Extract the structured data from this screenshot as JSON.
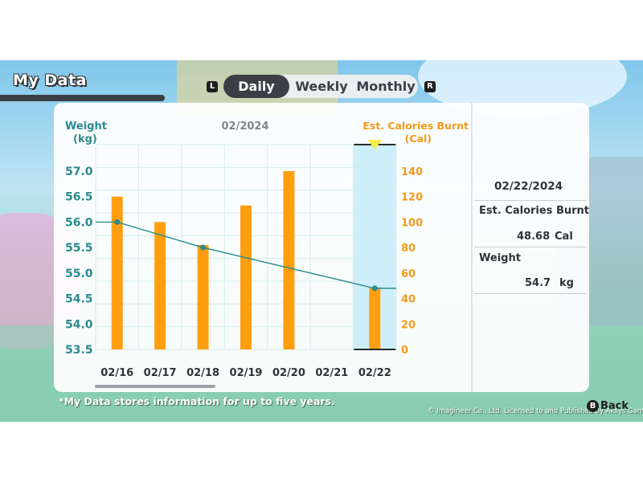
{
  "header": {
    "title": "My Data"
  },
  "tabs": [
    {
      "label": "Daily",
      "selected": true
    },
    {
      "label": "Weekly",
      "selected": false
    },
    {
      "label": "Monthly",
      "selected": false
    }
  ],
  "keys": {
    "left": "L",
    "right": "R",
    "back": "B"
  },
  "chart_header": {
    "left_axis_title": [
      "Weight",
      "(kg)"
    ],
    "period": "02/2024",
    "right_axis_title": [
      "Est. Calories Burnt",
      "(Cal)"
    ]
  },
  "chart_data": {
    "type": "bar",
    "categories": [
      "02/16",
      "02/17",
      "02/18",
      "02/19",
      "02/20",
      "02/21",
      "02/22"
    ],
    "series": [
      {
        "name": "Est. Calories Burnt",
        "axis": "right",
        "kind": "bar",
        "values": [
          120,
          100,
          82,
          113,
          140,
          0,
          48.68
        ]
      },
      {
        "name": "Weight",
        "axis": "left",
        "kind": "line",
        "values": [
          56.0,
          null,
          55.5,
          null,
          null,
          null,
          54.7
        ]
      }
    ],
    "left_ticks": [
      "57.0",
      "56.5",
      "56.0",
      "55.5",
      "55.0",
      "54.5",
      "54.0",
      "53.5"
    ],
    "right_ticks": [
      "140",
      "120",
      "100",
      "80",
      "60",
      "40",
      "20",
      "0"
    ],
    "ylim_left": [
      53.5,
      57.0
    ],
    "ylim_right": [
      0,
      140
    ],
    "selected_category": "02/22",
    "colors": {
      "bar": "#ff9f0f",
      "line": "#2c8a8e",
      "left_axis": "#2c8a8e",
      "right_axis": "#f39a1b",
      "highlight": "#cdeff8",
      "grid": "#d3ecef"
    }
  },
  "details": {
    "date": "02/22/2024",
    "calories_label": "Est. Calories Burnt",
    "calories_value": "48.68",
    "calories_unit": "Cal",
    "weight_label": "Weight",
    "weight_value": "54.7",
    "weight_unit": "kg"
  },
  "footer": {
    "note": "*My Data stores information for up to five years.",
    "copyright": "© Imagineer Co., Ltd. Licensed to and Published by Aksys Games.",
    "back_label": "Back"
  }
}
